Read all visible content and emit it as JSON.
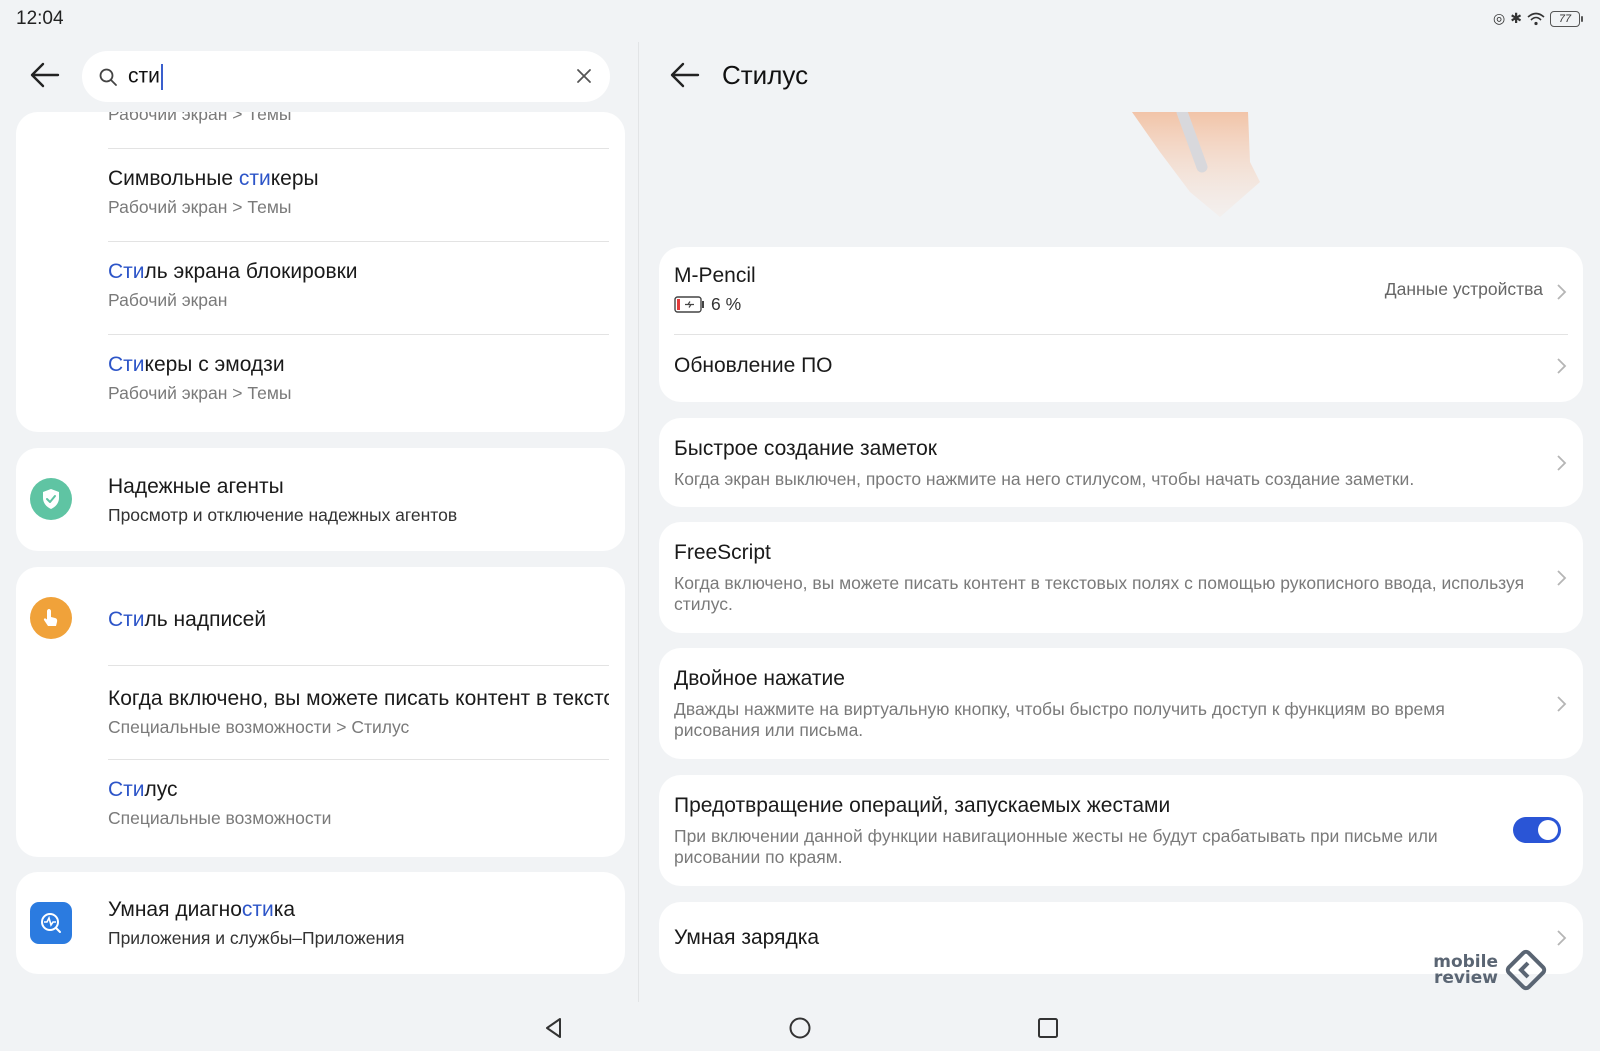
{
  "status_bar": {
    "time": "12:04",
    "battery": "77"
  },
  "search": {
    "query": "сти"
  },
  "results_card_1": {
    "partial_top_sub": "Рабочий экран > Темы",
    "items": [
      {
        "pre": "Символьные ",
        "hl": "сти",
        "post": "керы",
        "sub": "Рабочий экран > Темы"
      },
      {
        "pre": "",
        "hl": "Сти",
        "post": "ль экрана блокировки",
        "sub": "Рабочий экран"
      },
      {
        "pre": "",
        "hl": "Сти",
        "post": "керы с эмодзи",
        "sub": "Рабочий экран > Темы"
      }
    ]
  },
  "results_card_2": {
    "title": "Надежные агенты",
    "sub": "Просмотр и отключение надежных агентов",
    "icon_color": "#5fc4a3"
  },
  "results_card_3": {
    "icon_color": "#f0a23a",
    "head": {
      "pre": "",
      "hl": "Сти",
      "post": "ль надписей"
    },
    "items": [
      {
        "title": "Когда включено, вы можете писать контент в тексто",
        "sub": "Специальные возможности > Стилус"
      },
      {
        "pre": "",
        "hl": "Сти",
        "post": "лус",
        "sub": "Специальные возможности"
      }
    ]
  },
  "results_card_4": {
    "pre": "Умная диагно",
    "hl": "сти",
    "post": "ка",
    "sub": "Приложения и службы–Приложения",
    "icon_color": "#2b7be0"
  },
  "right_pane": {
    "title": "Стилус",
    "device": {
      "name": "M-Pencil",
      "battery": "6 %",
      "details_label": "Данные устройства"
    },
    "firmware_label": "Обновление ПО",
    "quick_notes": {
      "title": "Быстрое создание заметок",
      "desc": "Когда экран выключен, просто нажмите на него стилусом, чтобы начать создание заметки."
    },
    "freescript": {
      "title": "FreeScript",
      "desc": "Когда включено, вы можете писать контент в текстовых полях с помощью рукописного ввода, используя стилус."
    },
    "double_tap": {
      "title": "Двойное нажатие",
      "desc": "Дважды нажмите на виртуальную кнопку, чтобы быстро получить доступ к функциям во время рисования или письма."
    },
    "gesture_block": {
      "title": "Предотвращение операций, запускаемых жестами",
      "desc": "При включении данной функции навигационные жесты не будут срабатывать при письме или рисовании по краям.",
      "enabled": true
    },
    "smart_charge": {
      "title": "Умная зарядка"
    }
  },
  "watermark": {
    "line1": "mobile",
    "line2": "review"
  },
  "colors": {
    "accent": "#2d55c8",
    "toggle_on": "#2a55d6"
  }
}
